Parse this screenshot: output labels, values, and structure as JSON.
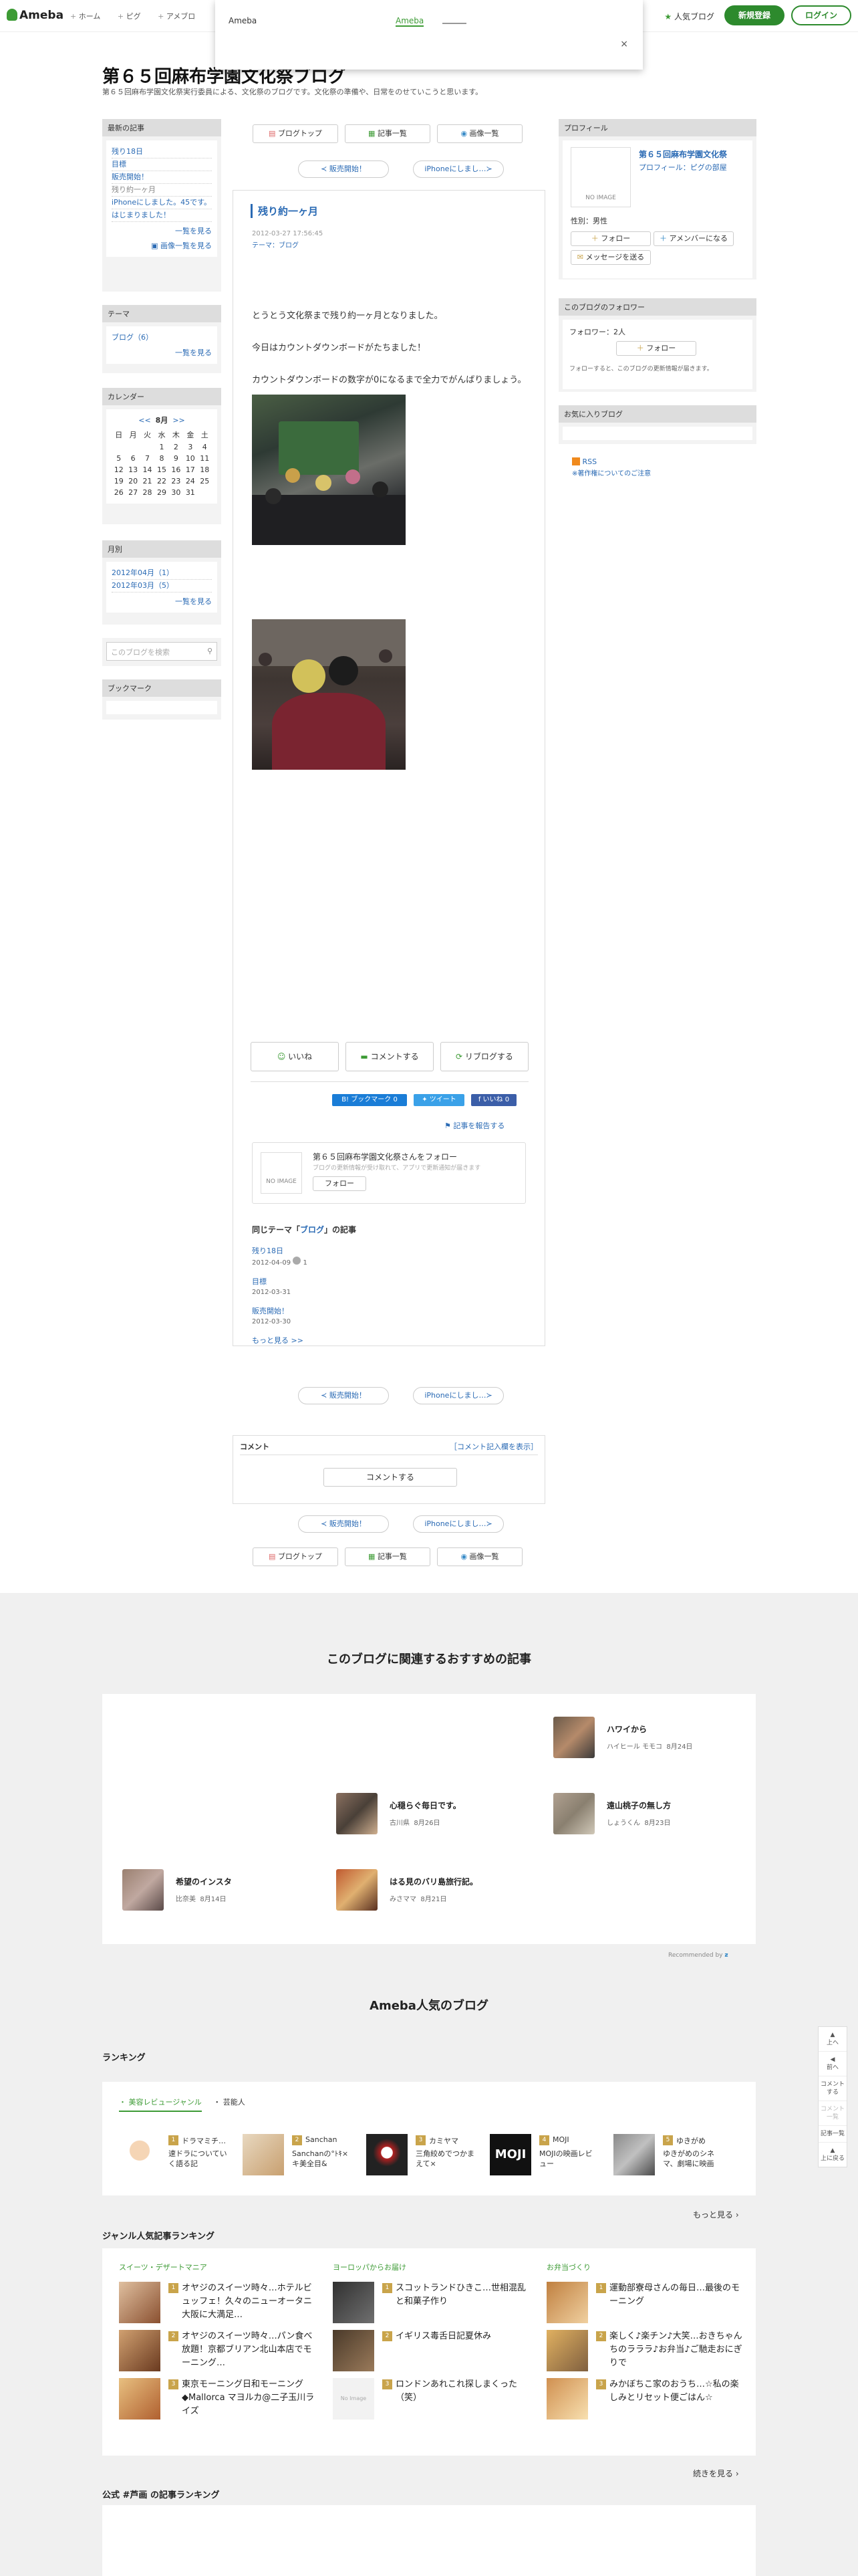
{
  "header": {
    "logo": "Ameba",
    "nav": [
      "ホーム",
      "ピグ",
      "アメブロ"
    ],
    "popular": "人気ブログ",
    "register": "新規登録",
    "login": "ログイン"
  },
  "overlay": {
    "left": "Ameba",
    "mid": "Ameba",
    "close": "×"
  },
  "blog": {
    "title": "第６５回麻布学園文化祭ブログ",
    "desc": "第６５回麻布学園文化祭実行委員による、文化祭のブログです。文化祭の準備や、日常をのせていこうと思います。"
  },
  "left": {
    "recent_title": "最新の記事",
    "recent": [
      "残り18日",
      "目標",
      "販売開始！",
      "残り約一ヶ月",
      "iPhoneにしました。45です。",
      "はじまりました！"
    ],
    "recent_more1": "一覧を見る",
    "recent_more2": "画像一覧を見る",
    "theme_title": "テーマ",
    "theme": "ブログ（6）",
    "theme_more": "一覧を見る",
    "cal_title": "カレンダー",
    "cal_month": "8月",
    "cal_days": [
      "日",
      "月",
      "火",
      "水",
      "木",
      "金",
      "土"
    ],
    "cal_rows": [
      [
        "",
        "",
        "",
        "1",
        "2",
        "3",
        "4"
      ],
      [
        "5",
        "6",
        "7",
        "8",
        "9",
        "10",
        "11"
      ],
      [
        "12",
        "13",
        "14",
        "15",
        "16",
        "17",
        "18"
      ],
      [
        "19",
        "20",
        "21",
        "22",
        "23",
        "24",
        "25"
      ],
      [
        "26",
        "27",
        "28",
        "29",
        "30",
        "31",
        ""
      ]
    ],
    "month_title": "月別",
    "months": [
      "2012年04月（1）",
      "2012年03月（5）"
    ],
    "month_more": "一覧を見る",
    "search_placeholder": "このブログを検索",
    "bookmark_title": "ブックマーク"
  },
  "topbuttons": [
    "ブログトップ",
    "記事一覧",
    "画像一覧"
  ],
  "pager": {
    "prev": "≺ 販売開始！",
    "next": "iPhoneにしまし…≻"
  },
  "entry": {
    "title": "残り約一ヶ月",
    "date": "2012-03-27 17:56:45",
    "theme": "テーマ：ブログ",
    "body": [
      "とうとう文化祭まで残り約一ヶ月となりました。",
      "今日はカウントダウンボードがたちました！",
      "カウントダウンボードの数字が0になるまで全力でがんばりましょう。"
    ],
    "like": "いいね",
    "comment": "コメントする",
    "reblog": "リブログする",
    "bookmark": "B! ブックマーク",
    "bookmark_count": "0",
    "tweet": "ツイート",
    "fb": "f いいね",
    "fb_count": "0",
    "report": "記事を報告する",
    "follow_title": "第６５回麻布学園文化祭さんをフォロー",
    "follow_sub": "ブログの更新情報が受け取れて、アプリで更新通知が届きます",
    "follow_btn": "フォロー",
    "same_title_pre": "同じテーマ「",
    "same_title_theme": "ブログ",
    "same_title_post": "」の記事",
    "same": [
      {
        "t": "残り18日",
        "d": "2012-04-09"
      },
      {
        "t": "目標",
        "d": "2012-03-31"
      },
      {
        "t": "販売開始！",
        "d": "2012-03-30"
      }
    ],
    "same_more": "もっと見る >>"
  },
  "comments": {
    "title": "コメント",
    "show": "［コメント記入欄を表示］",
    "btn": "コメントする"
  },
  "right": {
    "profile_title": "プロフィール",
    "name": "第６５回麻布学園文化祭",
    "profile_link": "プロフィール：ピグの部屋",
    "gender": "性別：男性",
    "follow": "フォロー",
    "amember": "アメンバーになる",
    "message": "メッセージを送る",
    "follower_title": "このブログのフォロワー",
    "follower_count": "フォロワー：2人",
    "follow_btn": "フォロー",
    "follow_note": "フォローすると、このブログの更新情報が届きます。",
    "fav_title": "お気に入りブログ",
    "rss": "RSS",
    "rss_note": "※著作権についてのご注意"
  },
  "recommend": {
    "title": "このブログに関連するおすすめの記事",
    "items": [
      {
        "t": "ハワイから",
        "a": "ハイヒール モモコ",
        "d": "8月24日"
      },
      {
        "t": "心穏らぐ毎日です。",
        "a": "古川県",
        "d": "8月26日"
      },
      {
        "t": "遠山桃子の無し方",
        "a": "しょうくん",
        "d": "8月23日"
      },
      {
        "t": "希望のインスタ",
        "a": "比奈美",
        "d": "8月14日"
      },
      {
        "t": "はる見のバリ島旅行記。",
        "a": "みさママ",
        "d": "8月21日"
      }
    ],
    "credit": "Recommended by"
  },
  "popular": {
    "title": "Ameba人気のブログ",
    "ranking": "ランキング",
    "tab1": "・ 美容レビュージャンル",
    "tab2": "・ 芸能人",
    "rank": [
      {
        "n": "1",
        "name": "ドラマミチ…",
        "desc": "速ドラについていく語る記"
      },
      {
        "n": "2",
        "name": "Sanchan",
        "desc": "Sanchanの°ﾄｷ×キ美全目&"
      },
      {
        "n": "3",
        "name": "カミヤマ",
        "desc": "三角絞めでつかまえて×"
      },
      {
        "n": "4",
        "name": "MOJI",
        "desc": "MOJIの映画レビュー"
      },
      {
        "n": "5",
        "name": "ゆきがめ",
        "desc": "ゆきがめのシネマ、劇場に映画"
      }
    ],
    "more": "もっと見る"
  },
  "genre": {
    "title": "ジャンル人気記事ランキング",
    "cols": [
      {
        "h": "スイーツ・デザートマニア",
        "items": [
          "オヤジのスイーツ時々…ホテルビュッフェ！久々のニューオータニ大阪に大満足…",
          "オヤジのスイーツ時々…パン食べ放題！京都ブリアン北山本店でモーニング…",
          "東京モーニング日和モーニング◆Mallorca マヨルカ@二子玉川ライズ"
        ]
      },
      {
        "h": "ヨーロッパからお届け",
        "items": [
          "スコットランドひきこ…世相混乱と和菓子作り",
          "イギリス毒舌日記夏休み",
          "ロンドンあれこれ探しまくった（笑）"
        ]
      },
      {
        "h": "お弁当づくり",
        "items": [
          "運動部寮母さんの毎日…最後のモーニング",
          "楽しく♪楽チン♪大笑…おきちゃんちのラララ♪お弁当♪ご馳走おにぎりで",
          "みかぼちこ家のおうち…☆私の楽しみとリセット便ごはん☆"
        ]
      }
    ],
    "more": "続きを見る"
  },
  "official": "公式 #芦画 の記事ランキング",
  "floatnav": [
    "上へ",
    "前へ",
    "コメントする",
    "コメント一覧",
    "記事一覧",
    "上に戻る"
  ]
}
